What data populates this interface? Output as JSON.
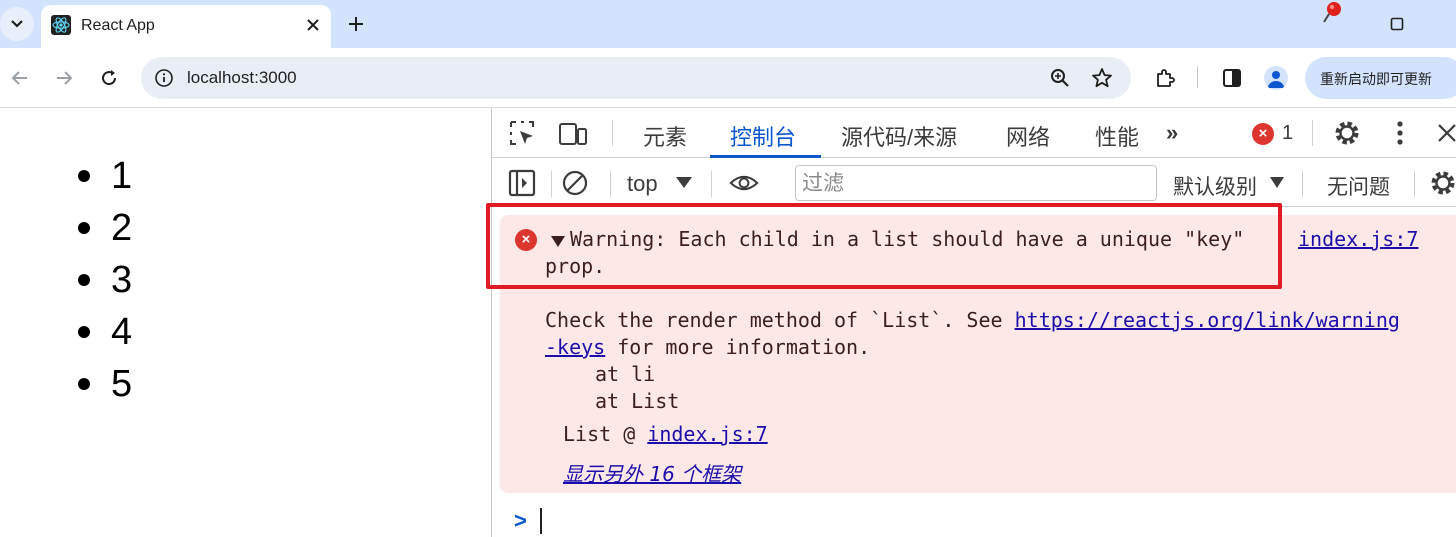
{
  "browser": {
    "tab": {
      "title": "React App"
    },
    "address": {
      "url": "localhost:3000"
    },
    "update_button": "重新启动即可更新"
  },
  "page": {
    "list_items": [
      "1",
      "2",
      "3",
      "4",
      "5"
    ]
  },
  "devtools": {
    "tabs": [
      {
        "label": "元素",
        "active": false
      },
      {
        "label": "控制台",
        "active": true
      },
      {
        "label": "源代码/来源",
        "active": false
      },
      {
        "label": "网络",
        "active": false
      },
      {
        "label": "性能",
        "active": false
      }
    ],
    "more_tabs": "»",
    "error_count": "1",
    "filter_bar": {
      "context": "top",
      "filter_placeholder": "过滤",
      "levels": "默认级别",
      "issues": "无问题"
    },
    "message": {
      "line1": "Warning: Each child in a list should have a unique \"key\"",
      "line2": "prop.",
      "source": "index.js:7",
      "detail_before": "Check the render method of `List`. See ",
      "detail_link_part1": "https://reactjs.org/link/warning",
      "detail_link_part2": "-keys",
      "detail_after": " for more information.",
      "stack": [
        "at li",
        "at List"
      ],
      "call_prefix": "List @ ",
      "call_source": "index.js:7",
      "show_frames": "显示另外 16 个框架"
    }
  },
  "colors": {
    "accent": "#0b57d0",
    "error_red": "#dc362e",
    "error_bg": "#fce8e6",
    "highlight": "#e01b24"
  }
}
